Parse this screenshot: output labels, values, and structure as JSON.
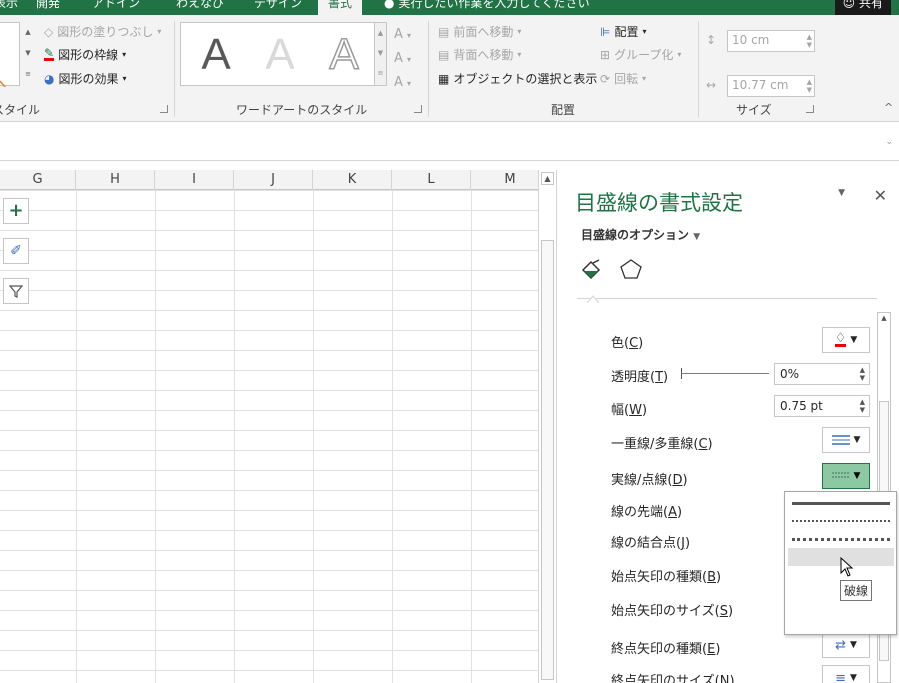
{
  "tabs": [
    {
      "label": "表示"
    },
    {
      "label": "開発"
    },
    {
      "label": "アドイン"
    },
    {
      "label": "わえなび"
    },
    {
      "label": "デザイン"
    },
    {
      "label": "書式"
    }
  ],
  "tell_me": "実行したい作業を入力してください",
  "share": "共有",
  "ribbon": {
    "shape_fill": "図形の塗りつぶし",
    "shape_outline": "図形の枠線",
    "shape_effects": "図形の効果",
    "shape_styles_group": "スタイル",
    "wordart_group": "ワードアートのスタイル",
    "wordart_letter": "A",
    "bring_forward": "前面へ移動",
    "send_backward": "背面へ移動",
    "selection_pane": "オブジェクトの選択と表示",
    "align": "配置",
    "group": "グループ化",
    "rotate": "回転",
    "arrange_group": "配置",
    "height": "10 cm",
    "width": "10.77 cm",
    "size_group": "サイズ"
  },
  "grid": {
    "columns": [
      "G",
      "H",
      "I",
      "J",
      "K",
      "L",
      "M"
    ]
  },
  "pane": {
    "title": "目盛線の書式設定",
    "options": "目盛線のオプション",
    "props": [
      {
        "name": "色",
        "key": "C"
      },
      {
        "name": "透明度",
        "key": "T"
      },
      {
        "name": "幅",
        "key": "W"
      },
      {
        "name": "一重線/多重線",
        "key": "C"
      },
      {
        "name": "実線/点線",
        "key": "D"
      },
      {
        "name": "線の先端",
        "key": "A"
      },
      {
        "name": "線の結合点",
        "key": "J"
      },
      {
        "name": "始点矢印の種類",
        "key": "B"
      },
      {
        "name": "始点矢印のサイズ",
        "key": "S"
      },
      {
        "name": "終点矢印の種類",
        "key": "E"
      },
      {
        "name": "終点矢印のサイズ",
        "key": "N"
      }
    ],
    "transparency": "0%",
    "width_value": "0.75 pt"
  },
  "tooltip": "破線",
  "colors": {
    "accent": "#217346",
    "selected_dd": "#8cc8a2"
  }
}
